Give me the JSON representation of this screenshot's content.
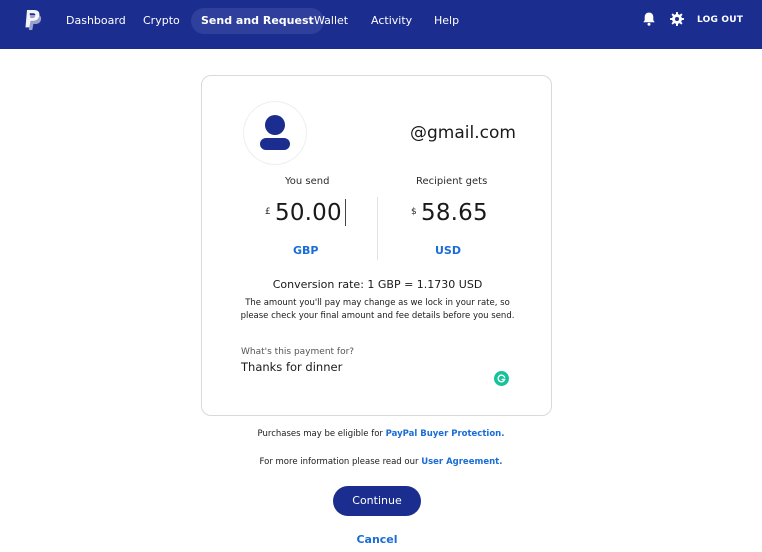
{
  "nav": {
    "items": [
      {
        "label": "Dashboard",
        "active": false
      },
      {
        "label": "Crypto",
        "active": false
      },
      {
        "label": "Send and Request",
        "active": true
      },
      {
        "label": "Wallet",
        "active": false
      },
      {
        "label": "Activity",
        "active": false
      },
      {
        "label": "Help",
        "active": false
      }
    ],
    "logout_label": "LOG OUT",
    "icons": [
      "bell-icon",
      "gear-icon"
    ],
    "bg_color": "#1b2d8f"
  },
  "recipient": {
    "email": "@gmail.com"
  },
  "send": {
    "label": "You send",
    "currency_symbol": "£",
    "amount": "50.00",
    "currency_code": "GBP"
  },
  "receive": {
    "label": "Recipient gets",
    "currency_symbol": "$",
    "amount": "58.65",
    "currency_code": "USD"
  },
  "conversion": {
    "rate_text": "Conversion rate: 1 GBP = 1.1730 USD",
    "disclaimer": "The amount you'll pay may change as we lock in your rate, so please check your final amount and fee details before you send."
  },
  "note": {
    "label": "What's this payment for?",
    "value": "Thanks for dinner"
  },
  "footer": {
    "protection_prefix": "Purchases may be eligible for ",
    "protection_link": "PayPal Buyer Protection.",
    "agreement_prefix": "For more information please read our ",
    "agreement_link": "User Agreement."
  },
  "actions": {
    "continue_label": "Continue",
    "cancel_label": "Cancel"
  },
  "colors": {
    "accent": "#1a6dd6",
    "primary": "#1b2d8f",
    "grammarly": "#15c39a"
  }
}
